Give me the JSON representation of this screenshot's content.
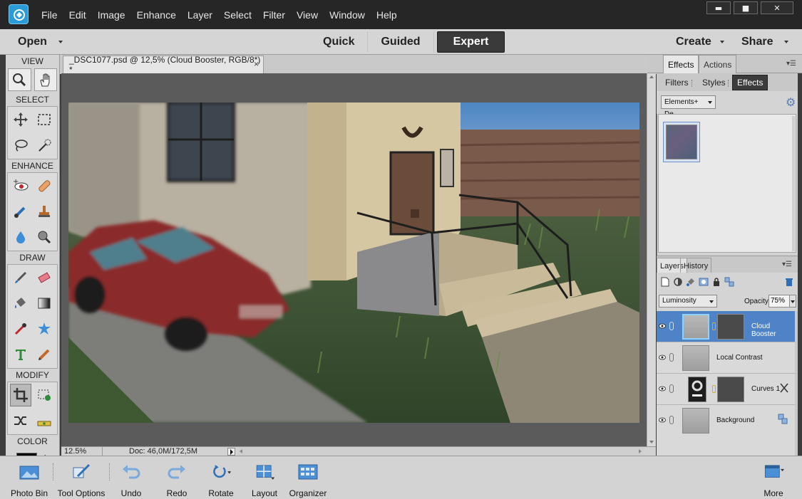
{
  "menu": [
    "File",
    "Edit",
    "Image",
    "Enhance",
    "Layer",
    "Select",
    "Filter",
    "View",
    "Window",
    "Help"
  ],
  "window_controls": {
    "minimize": "▬",
    "maximize": "■",
    "close": "✕"
  },
  "modebar": {
    "open_label": "Open",
    "modes": [
      "Quick",
      "Guided",
      "Expert"
    ],
    "active_mode": "Expert",
    "create_label": "Create",
    "share_label": "Share"
  },
  "toolbox": {
    "view_label": "VIEW",
    "select_label": "SELECT",
    "enhance_label": "ENHANCE",
    "draw_label": "DRAW",
    "modify_label": "MODIFY",
    "color_label": "COLOR",
    "foreground_color": "#000000"
  },
  "document": {
    "tab_title": "_DSC1077.psd @ 12,5% (Cloud Booster, RGB/8*) *",
    "close_glyph": "×",
    "zoom": "12.5%",
    "doc_size": "Doc: 46,0M/172,5M"
  },
  "right_panel": {
    "top_tabs": [
      "Effects",
      "Actions"
    ],
    "active_top_tab": "Effects",
    "effect_subtabs": [
      "Filters",
      "Styles",
      "Effects"
    ],
    "active_subtab": "Effects",
    "category_dropdown": "Elements+ De...",
    "layers_tabs": [
      "Layers",
      "History"
    ],
    "blend_mode": "Luminosity",
    "opacity_label": "Opacity:",
    "opacity_value": "75%",
    "layers": [
      {
        "name": "Cloud Booster",
        "selected": true
      },
      {
        "name": "Local Contrast",
        "selected": false
      },
      {
        "name": "Curves 1",
        "selected": false
      },
      {
        "name": "Background",
        "selected": false
      }
    ]
  },
  "bottombar": {
    "items": [
      "Photo Bin",
      "Tool Options",
      "Undo",
      "Redo",
      "Rotate",
      "Layout",
      "Organizer"
    ],
    "more_label": "More"
  },
  "colors": {
    "accent_blue": "#4f83c7",
    "menubar_bg": "#262626",
    "panel_bg": "#d4d4d4"
  }
}
